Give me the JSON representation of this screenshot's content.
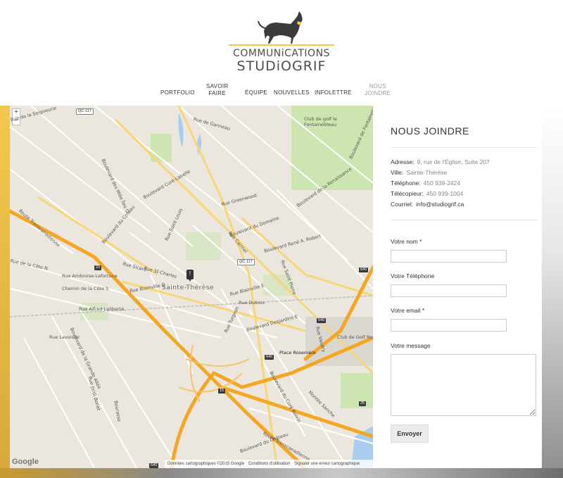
{
  "logo": {
    "line1": "COMMUNiCATIONS",
    "line2": "STUDiOGRIF",
    "dog_icon": "greyhound-dog-icon"
  },
  "nav": {
    "items": [
      {
        "label": "PORTFOLIO",
        "active": false
      },
      {
        "label": "SAVOIR\nFAIRE",
        "active": false
      },
      {
        "label": "ÉQUIPE",
        "active": false
      },
      {
        "label": "NOUVELLES",
        "active": false
      },
      {
        "label": "INFOLETTRE",
        "active": false
      },
      {
        "label": "NOUS\nJOINDRE",
        "active": true
      }
    ]
  },
  "map": {
    "zoom_in": "+",
    "zoom_out": "−",
    "city_label": "Sainte-Thérèse",
    "google": "Google",
    "footer": {
      "data": "Données cartographiques ©2015 Google",
      "terms": "Conditions d'utilisation",
      "report": "Signaler une erreur cartographique"
    },
    "labels": {
      "cure_labelle": "Boulevard Curé-Labelle",
      "transcanadienne": "Route Transcanadienne",
      "transcanadienne2": "Route Transcanadienne",
      "golf_fontainebleau": "Club de golf le Fontainebleau",
      "golf_rosemere": "Club de Golf Rosemère",
      "place_rosemere": "Place Rosemère",
      "du_domaine": "Boulevard du Domaine",
      "rene_robert": "Boulevard René A. Robert",
      "renaissance": "Boulevard de la Renaissance",
      "blainville_e": "Rue Blainville E",
      "blainville_o": "Rue Blainville O",
      "st_charles": "Rue St-Charles",
      "sicard": "Rue Sicard",
      "turgeon": "Rue Turgeon",
      "desjardins": "Boulevard Desjardins E",
      "grande_allee": "Boulevard de la Grande Allée",
      "mille_iles": "Boulevard des Mille Îles O",
      "cote_n": "Rue de la Côte N",
      "cote_s": "Chemin de la Côte S",
      "cure_boivin": "Boulevard du Curé Boivin",
      "chateau": "Boulevard du Château",
      "fontainebleau": "Boulevard de Fontainebleau",
      "coteau": "Boulevard du Coteau",
      "ambroise": "Rue Ambroise-Lafortune",
      "alfred": "Rue Alfred Laliberté",
      "lavoisier": "Rue Lavoisier",
      "jordi": "Rue Jordi Bonet",
      "bourassa": "Bourassa",
      "saint_pierre": "Rue Saint Pierre",
      "vaudry": "Rue Vaudry",
      "dubois": "Rue Dubois",
      "montee_sanche": "Montée Sanche",
      "ganneau": "Rue de Ganneau",
      "greenwood": "Rue Greenwood",
      "carmel": "Rue Carmel",
      "saint_louis": "Rue Saint Louis",
      "seigneurie": "Rue de la Seigneurie"
    },
    "shields": [
      "QC-117",
      "QC-117",
      "640",
      "640",
      "640",
      "15",
      "640",
      "23",
      "25"
    ]
  },
  "contact": {
    "title": "NOUS JOINDRE",
    "address_label": "Adresse:",
    "address": "9, rue de l'Église, Suite 207",
    "city_label": "Ville:",
    "city": "Sainte-Thérèse",
    "phone_label": "Téléphone:",
    "phone": "450 939-2424",
    "fax_label": "Télécopieur:",
    "fax": "450 939-1004",
    "email_label": "Courriel:",
    "email": "info@studiogrif.ca"
  },
  "form": {
    "name_label": "Votre nom *",
    "phone_label": "Votre Téléphone",
    "email_label": "Votre email *",
    "message_label": "Votre message",
    "name_value": "",
    "phone_value": "",
    "email_value": "",
    "message_value": "",
    "submit": "Envoyer"
  },
  "colors": {
    "accent": "#f2c94c",
    "highway": "#f5a623",
    "map_bg": "#ebe7df",
    "park": "#cde5b0",
    "water": "#a9cdf0"
  }
}
